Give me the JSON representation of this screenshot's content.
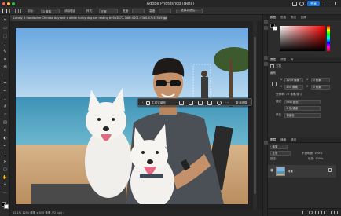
{
  "window": {
    "title": "Adobe Photoshop (Beta)",
    "share_label": "共享",
    "colors": {
      "close": "#ff5f57",
      "min": "#febc2e",
      "max": "#28c840",
      "accent": "#1a6fd6"
    }
  },
  "options_bar": {
    "items": [
      "羽化：",
      "0 像素",
      "消除锯齿",
      "样式：",
      "正常",
      "宽度：",
      "高度：",
      "选择并遮住..."
    ]
  },
  "document": {
    "tab_label": "Lonely A handsome Chinese boy and a white husky dog are resting b90a3b72-7d8f-4401-93e0-47c325a5f4db.png @ 15.1%(RGB/8#)",
    "zoom": "15.1%",
    "status": "15.1%   1255 像素 x 835 像素 (72 ppi)  ›"
  },
  "context_bar": {
    "generate_label": "生成式填充",
    "deselect_label": "取消选择"
  },
  "tools": [
    "move",
    "artboard",
    "marquee",
    "lasso",
    "quick-select",
    "crop",
    "frame",
    "eyedropper",
    "healing",
    "brush",
    "stamp",
    "history-brush",
    "eraser",
    "gradient",
    "blur",
    "dodge",
    "pen",
    "type",
    "path-select",
    "rectangle",
    "hand",
    "zoom",
    "more"
  ],
  "right_panel": {
    "color_tabs": [
      "颜色",
      "色板",
      "渐变",
      "图案"
    ],
    "properties_tabs": [
      "属性",
      "调整",
      "库"
    ],
    "doc_label": "文档",
    "canvas_section": "画布",
    "width_label": "W",
    "width_value": "1255 像素",
    "height_label": "H",
    "height_value": "835 像素",
    "x_label": "X",
    "x_value": "0 像素",
    "y_label": "Y",
    "y_value": "0 像素",
    "resolution_label": "分辨率: 72 像素/英寸",
    "mode_label": "模式",
    "mode_value": "RGB 颜色",
    "depth_value": "8 位/通道",
    "fill_label": "填充",
    "fill_value": "背景色",
    "layers_tabs": [
      "图层",
      "通道",
      "路径"
    ],
    "layer_kind": "种类",
    "blend_value": "正常",
    "opacity_label": "不透明度: 100%",
    "lock_label": "锁定:",
    "fill_pct_label": "填充: 100%",
    "layer_name": "背景"
  }
}
